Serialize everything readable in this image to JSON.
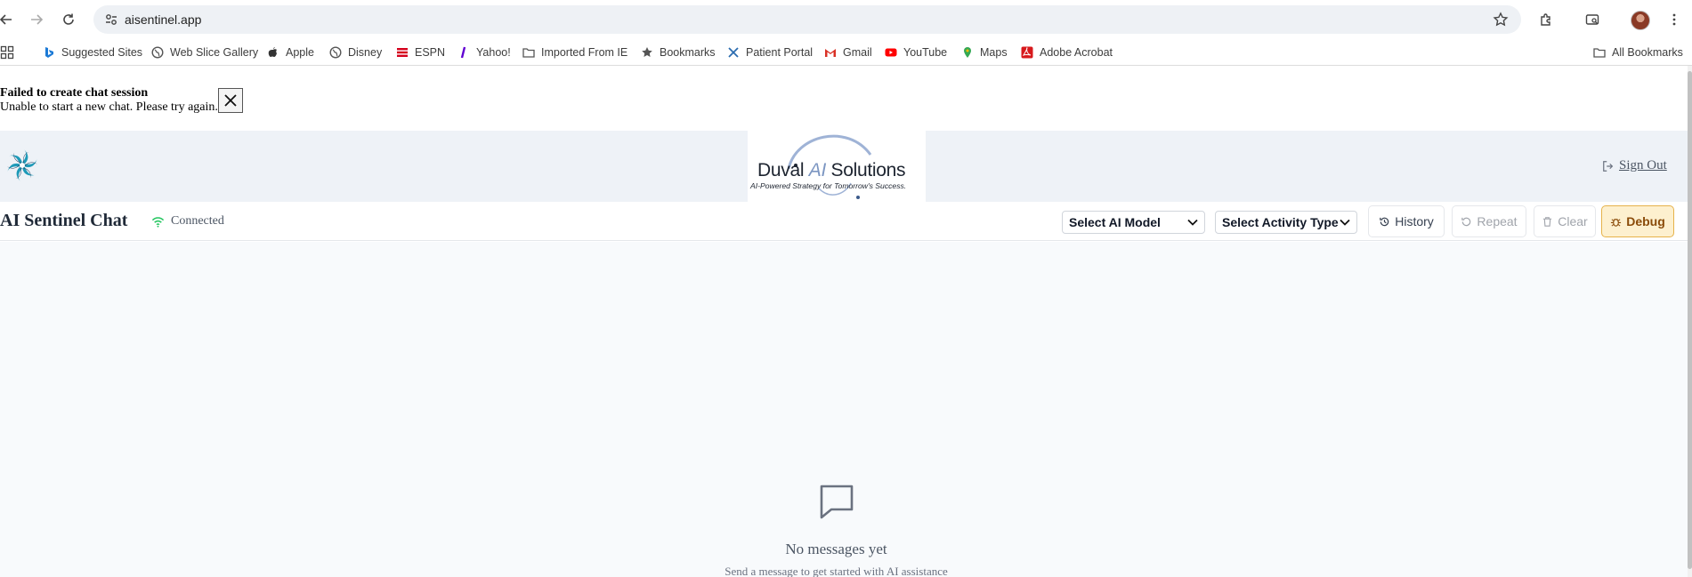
{
  "browser": {
    "url": "aisentinel.app",
    "bookmarks": [
      {
        "label": "Suggested Sites",
        "icon": "bing-icon"
      },
      {
        "label": "Web Slice Gallery",
        "icon": "globe-icon"
      },
      {
        "label": "Apple",
        "icon": "apple-icon"
      },
      {
        "label": "Disney",
        "icon": "globe-icon"
      },
      {
        "label": "ESPN",
        "icon": "espn-icon"
      },
      {
        "label": "Yahoo!",
        "icon": "yahoo-icon"
      },
      {
        "label": "Imported From IE",
        "icon": "folder-icon"
      },
      {
        "label": "Bookmarks",
        "icon": "star-icon"
      },
      {
        "label": "Patient Portal",
        "icon": "portal-icon"
      },
      {
        "label": "Gmail",
        "icon": "gmail-icon"
      },
      {
        "label": "YouTube",
        "icon": "youtube-icon"
      },
      {
        "label": "Maps",
        "icon": "maps-icon"
      },
      {
        "label": "Adobe Acrobat",
        "icon": "acrobat-icon"
      }
    ],
    "all_bookmarks": "All Bookmarks"
  },
  "error": {
    "title": "Failed to create chat session",
    "message": "Unable to start a new chat. Please try again."
  },
  "header": {
    "brand_name_pre": "Duval ",
    "brand_name_ai": "AI",
    "brand_name_post": " Solutions",
    "brand_tagline": "AI-Powered Strategy for Tomorrow's Success.",
    "sign_out": "Sign Out"
  },
  "toolbar": {
    "title": "AI Sentinel Chat",
    "status": "Connected",
    "model_select": "Select AI Model",
    "activity_select": "Select Activity Type",
    "history": "History",
    "repeat": "Repeat",
    "clear": "Clear",
    "debug": "Debug"
  },
  "empty_state": {
    "title": "No messages yet",
    "subtitle": "Send a message to get started with AI assistance"
  },
  "colors": {
    "status_green": "#22c55e",
    "debug_bg": "#fdf0cf",
    "debug_border": "#e6b24a",
    "band_bg": "#eef2f7"
  }
}
